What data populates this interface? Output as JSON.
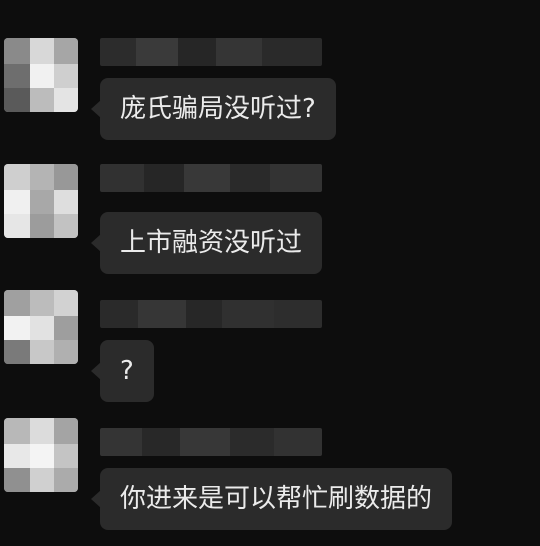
{
  "messages": [
    {
      "text": "庞氏骗局没听过?"
    },
    {
      "text": "上市融资没听过"
    },
    {
      "text": "?"
    },
    {
      "text": "你进来是可以帮忙刷数据的"
    }
  ],
  "colors": {
    "background": "#0d0d0d",
    "bubble": "#2b2b2b",
    "message_text": "#ebebeb"
  }
}
